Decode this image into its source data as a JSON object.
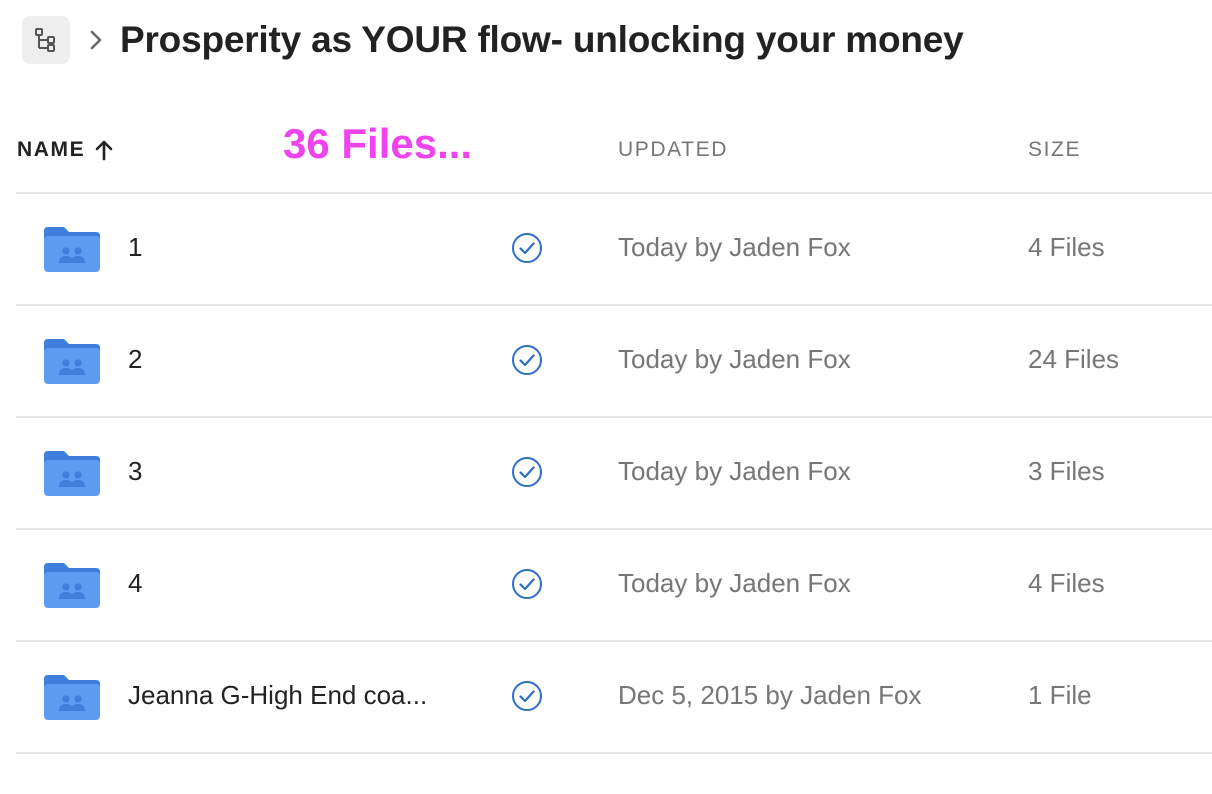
{
  "header": {
    "tree_icon": "folder-tree-icon",
    "chevron_icon": "chevron-right-icon",
    "title": "Prosperity as YOUR flow- unlocking your money"
  },
  "columns": {
    "name": "NAME",
    "sort_icon": "arrow-up-icon",
    "updated": "UPDATED",
    "size": "SIZE"
  },
  "overlay_note": "36 Files...",
  "rows": [
    {
      "name": "1",
      "updated": "Today by Jaden Fox",
      "size": "4 Files",
      "icon": "shared-folder-icon",
      "status_icon": "synced-check-icon"
    },
    {
      "name": "2",
      "updated": "Today by Jaden Fox",
      "size": "24 Files",
      "icon": "shared-folder-icon",
      "status_icon": "synced-check-icon"
    },
    {
      "name": "3",
      "updated": "Today by Jaden Fox",
      "size": "3 Files",
      "icon": "shared-folder-icon",
      "status_icon": "synced-check-icon"
    },
    {
      "name": "4",
      "updated": "Today by Jaden Fox",
      "size": "4 Files",
      "icon": "shared-folder-icon",
      "status_icon": "synced-check-icon"
    },
    {
      "name": "Jeanna G-High End coa...",
      "updated": "Dec 5, 2015 by Jaden Fox",
      "size": "1 File",
      "icon": "shared-folder-icon",
      "status_icon": "synced-check-icon"
    }
  ],
  "colors": {
    "folder": "#5b9bf0",
    "folder_tab": "#3f7fdc",
    "check": "#2f6ec6",
    "overlay": "#ee44ee"
  }
}
